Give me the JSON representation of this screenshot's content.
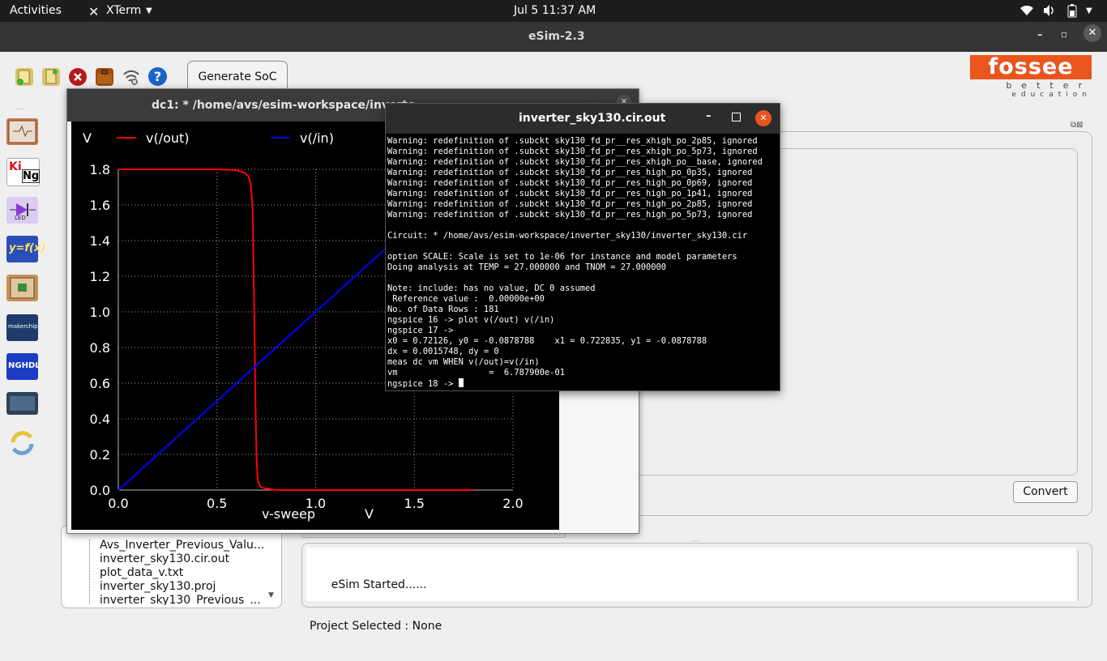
{
  "topbar": {
    "activities": "Activities",
    "app": "XTerm",
    "datetime": "Jul 5  11:37 AM"
  },
  "esim": {
    "title": "eSim-2.3",
    "generate_soc": "Generate SoC",
    "convert": "Convert",
    "fossee_logo": "fossee",
    "fossee_tagline1": "better",
    "fossee_tagline2": "education",
    "toolbar_icons": [
      "new-project-icon",
      "open-project-icon",
      "close-project-icon",
      "toolbox-icon",
      "wifi-off-icon",
      "help-icon"
    ],
    "sidebar_icons": [
      "schematic-icon",
      "kicad-ngspice-icon",
      "led-icon",
      "yfx-icon",
      "pcb-icon",
      "makerchip-icon",
      "nghdl-icon",
      "omedit-icon",
      "refresh-icon"
    ],
    "makerchip_label": "makerchip",
    "nghdl_label": "NGHDL",
    "yfx_label": "y=f(x)",
    "kicad_label": "Ki",
    "ng_label": "Ng",
    "led_label": "LED",
    "tree_items": [
      "Avs_Inverter_Previous_Valu...",
      "inverter_sky130.cir.out",
      "plot_data_v.txt",
      "inverter_sky130.proj",
      "inverter_sky130_Previous_..."
    ],
    "console_lines": [
      "      eSim Started......",
      "Project Selected : None"
    ]
  },
  "plot_window": {
    "title": "dc1: * /home/avs/esim-workspace/inverte..."
  },
  "terminal": {
    "title": "inverter_sky130.cir.out",
    "lines": [
      "Warning: redefinition of .subckt sky130_fd_pr__res_xhigh_po_2p85, ignored",
      "Warning: redefinition of .subckt sky130_fd_pr__res_xhigh_po_5p73, ignored",
      "Warning: redefinition of .subckt sky130_fd_pr__res_xhigh_po__base, ignored",
      "Warning: redefinition of .subckt sky130_fd_pr__res_high_po_0p35, ignored",
      "Warning: redefinition of .subckt sky130_fd_pr__res_high_po_0p69, ignored",
      "Warning: redefinition of .subckt sky130_fd_pr__res_high_po_1p41, ignored",
      "Warning: redefinition of .subckt sky130_fd_pr__res_high_po_2p85, ignored",
      "Warning: redefinition of .subckt sky130_fd_pr__res_high_po_5p73, ignored",
      "",
      "Circuit: * /home/avs/esim-workspace/inverter_sky130/inverter_sky130.cir",
      "",
      "option SCALE: Scale is set to 1e-06 for instance and model parameters",
      "Doing analysis at TEMP = 27.000000 and TNOM = 27.000000",
      "",
      "Note: include: has no value, DC 0 assumed",
      " Reference value :  0.00000e+00",
      "No. of Data Rows : 181",
      "ngspice 16 -> plot v(/out) v(/in)",
      "ngspice 17 ->",
      "x0 = 0.72126, y0 = -0.0878788    x1 = 0.722835, y1 = -0.0878788",
      "dx = 0.0015748, dy = 0",
      "meas dc vm WHEN v(/out)=v(/in)",
      "vm                  =  6.787900e-01",
      "ngspice 18 -> "
    ]
  },
  "chart_data": {
    "type": "line",
    "xlabel": "v-sweep",
    "xunit": "V",
    "yunit": "V",
    "xlim": [
      0.0,
      2.0
    ],
    "ylim": [
      0.0,
      1.8
    ],
    "xticks": [
      "0.0",
      "0.5",
      "1.0",
      "1.5",
      "2.0"
    ],
    "yticks": [
      "0.0",
      "0.2",
      "0.4",
      "0.6",
      "0.8",
      "1.0",
      "1.2",
      "1.4",
      "1.6",
      "1.8"
    ],
    "grid": true,
    "legend_position": "top",
    "background": "#000000",
    "series": [
      {
        "name": "v(/out)",
        "color": "#ff0000",
        "x": [
          0.0,
          0.5,
          0.6,
          0.64,
          0.66,
          0.67,
          0.68,
          0.685,
          0.69,
          0.695,
          0.7,
          0.705,
          0.71,
          0.72,
          0.74,
          0.8,
          1.0,
          1.5,
          1.8
        ],
        "y": [
          1.8,
          1.8,
          1.795,
          1.78,
          1.76,
          1.72,
          1.6,
          1.3,
          0.9,
          0.5,
          0.2,
          0.08,
          0.04,
          0.02,
          0.01,
          0.0,
          0.0,
          0.0,
          0.0
        ]
      },
      {
        "name": "v(/in)",
        "color": "#0000ff",
        "x": [
          0.0,
          1.8
        ],
        "y": [
          0.0,
          1.8
        ]
      }
    ]
  }
}
